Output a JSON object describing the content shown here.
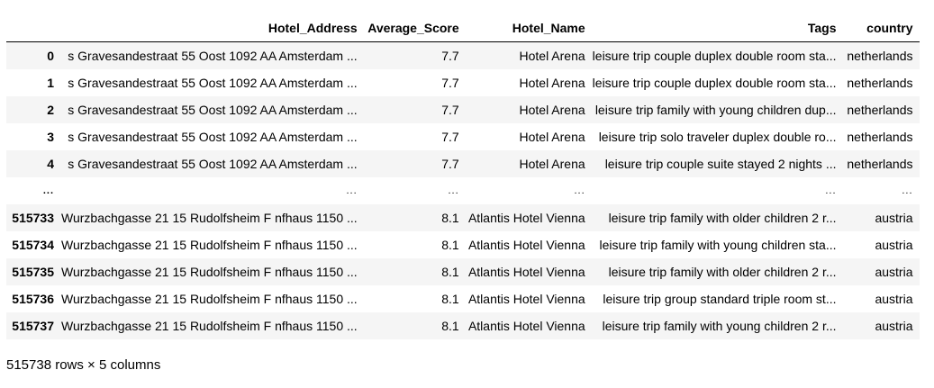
{
  "dataframe": {
    "columns": [
      "Hotel_Address",
      "Average_Score",
      "Hotel_Name",
      "Tags",
      "country"
    ],
    "rows": [
      {
        "index": "0",
        "Hotel_Address": "s Gravesandestraat 55 Oost 1092 AA Amsterdam ...",
        "Average_Score": "7.7",
        "Hotel_Name": "Hotel Arena",
        "Tags": "leisure trip couple duplex double room sta...",
        "country": "netherlands"
      },
      {
        "index": "1",
        "Hotel_Address": "s Gravesandestraat 55 Oost 1092 AA Amsterdam ...",
        "Average_Score": "7.7",
        "Hotel_Name": "Hotel Arena",
        "Tags": "leisure trip couple duplex double room sta...",
        "country": "netherlands"
      },
      {
        "index": "2",
        "Hotel_Address": "s Gravesandestraat 55 Oost 1092 AA Amsterdam ...",
        "Average_Score": "7.7",
        "Hotel_Name": "Hotel Arena",
        "Tags": "leisure trip family with young children dup...",
        "country": "netherlands"
      },
      {
        "index": "3",
        "Hotel_Address": "s Gravesandestraat 55 Oost 1092 AA Amsterdam ...",
        "Average_Score": "7.7",
        "Hotel_Name": "Hotel Arena",
        "Tags": "leisure trip solo traveler duplex double ro...",
        "country": "netherlands"
      },
      {
        "index": "4",
        "Hotel_Address": "s Gravesandestraat 55 Oost 1092 AA Amsterdam ...",
        "Average_Score": "7.7",
        "Hotel_Name": "Hotel Arena",
        "Tags": "leisure trip couple suite stayed 2 nights ...",
        "country": "netherlands"
      },
      {
        "index": "...",
        "Hotel_Address": "...",
        "Average_Score": "...",
        "Hotel_Name": "...",
        "Tags": "...",
        "country": "..."
      },
      {
        "index": "515733",
        "Hotel_Address": "Wurzbachgasse 21 15 Rudolfsheim F nfhaus 1150 ...",
        "Average_Score": "8.1",
        "Hotel_Name": "Atlantis Hotel Vienna",
        "Tags": "leisure trip family with older children 2 r...",
        "country": "austria"
      },
      {
        "index": "515734",
        "Hotel_Address": "Wurzbachgasse 21 15 Rudolfsheim F nfhaus 1150 ...",
        "Average_Score": "8.1",
        "Hotel_Name": "Atlantis Hotel Vienna",
        "Tags": "leisure trip family with young children sta...",
        "country": "austria"
      },
      {
        "index": "515735",
        "Hotel_Address": "Wurzbachgasse 21 15 Rudolfsheim F nfhaus 1150 ...",
        "Average_Score": "8.1",
        "Hotel_Name": "Atlantis Hotel Vienna",
        "Tags": "leisure trip family with older children 2 r...",
        "country": "austria"
      },
      {
        "index": "515736",
        "Hotel_Address": "Wurzbachgasse 21 15 Rudolfsheim F nfhaus 1150 ...",
        "Average_Score": "8.1",
        "Hotel_Name": "Atlantis Hotel Vienna",
        "Tags": "leisure trip group standard triple room st...",
        "country": "austria"
      },
      {
        "index": "515737",
        "Hotel_Address": "Wurzbachgasse 21 15 Rudolfsheim F nfhaus 1150 ...",
        "Average_Score": "8.1",
        "Hotel_Name": "Atlantis Hotel Vienna",
        "Tags": "leisure trip family with young children 2 r...",
        "country": "austria"
      }
    ],
    "shape_text": "515738 rows × 5 columns"
  },
  "colors": {
    "stripe": "#f5f5f5",
    "header_border": "#000000"
  }
}
